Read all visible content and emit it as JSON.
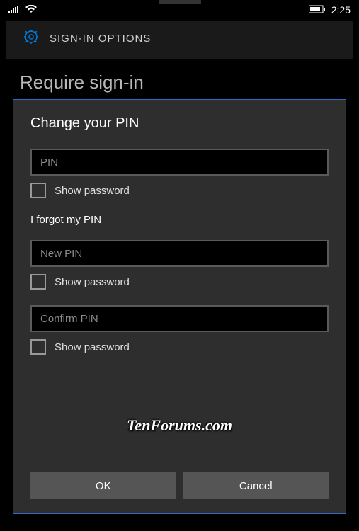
{
  "status": {
    "time": "2:25"
  },
  "header": {
    "title": "SIGN-IN OPTIONS"
  },
  "section": {
    "title": "Require sign-in"
  },
  "dialog": {
    "title": "Change your PIN",
    "pin_placeholder": "PIN",
    "new_pin_placeholder": "New PIN",
    "confirm_pin_placeholder": "Confirm PIN",
    "show_password_label": "Show password",
    "forgot_link": "I forgot my PIN",
    "ok_label": "OK",
    "cancel_label": "Cancel"
  },
  "watermark": "TenForums.com"
}
